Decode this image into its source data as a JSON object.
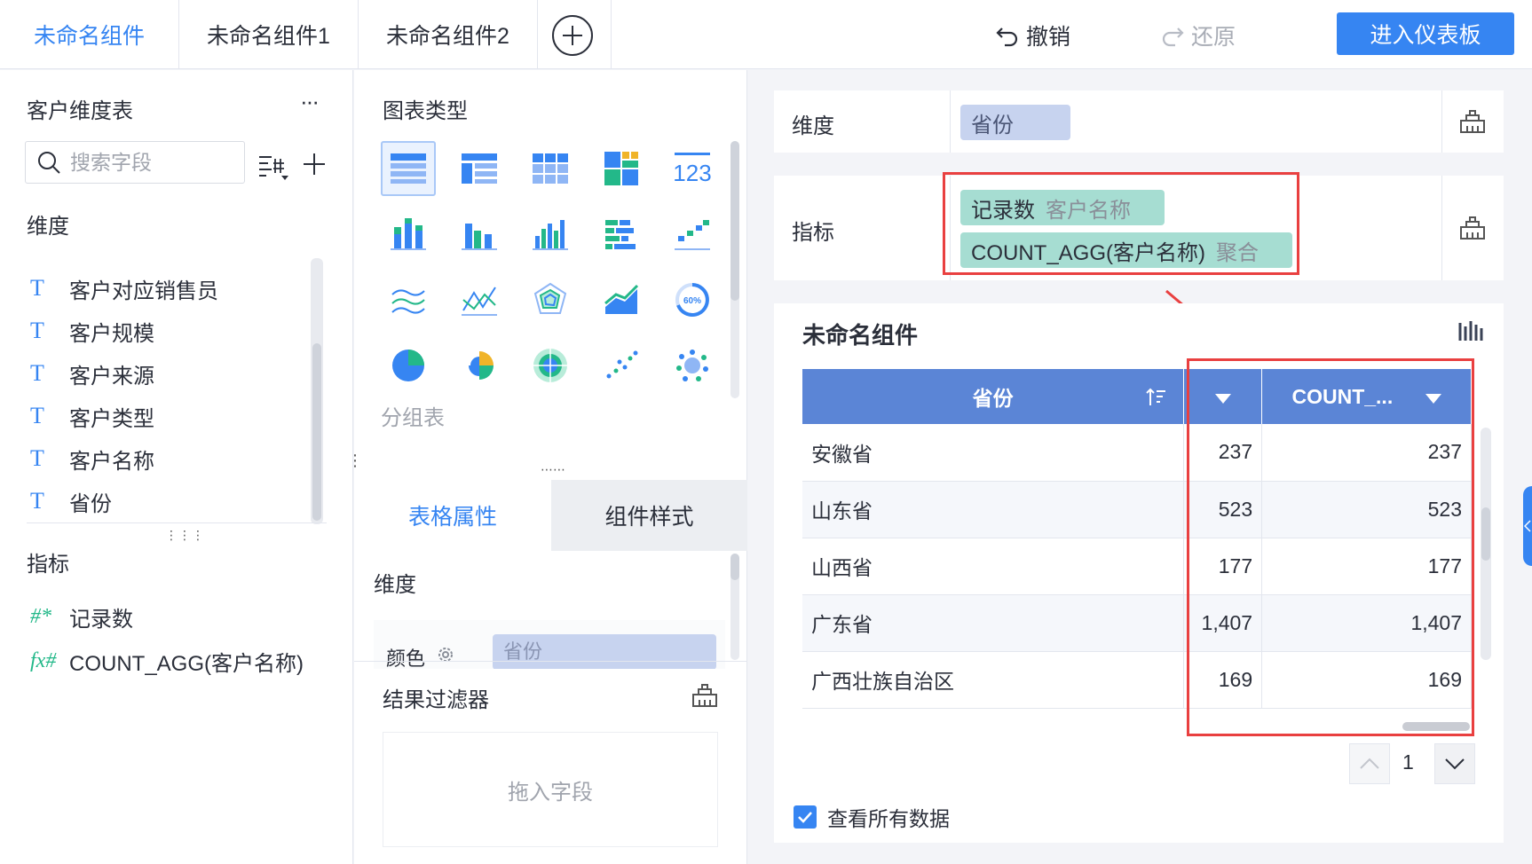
{
  "tabs": [
    {
      "label": "未命名组件",
      "active": true
    },
    {
      "label": "未命名组件1",
      "active": false
    },
    {
      "label": "未命名组件2",
      "active": false
    }
  ],
  "toolbar": {
    "undo": "撤销",
    "redo": "还原",
    "enter_dashboard": "进入仪表板"
  },
  "left": {
    "table_name": "客户维度表",
    "more": "···",
    "search_placeholder": "搜索字段",
    "dimension_title": "维度",
    "dimensions": [
      "客户对应销售员",
      "客户规模",
      "客户来源",
      "客户类型",
      "客户名称",
      "省份"
    ],
    "measure_title": "指标",
    "measures": [
      {
        "icon": "#*",
        "label": "记录数"
      },
      {
        "icon": "fx#",
        "label": "COUNT_AGG(客户名称)"
      }
    ]
  },
  "middle": {
    "chart_type_title": "图表类型",
    "selected_chart_label": "分组表",
    "tabs": [
      "表格属性",
      "组件样式"
    ],
    "dimension_label": "维度",
    "color_label": "颜色",
    "color_field": "省份",
    "filter_title": "结果过滤器",
    "drop_hint": "拖入字段"
  },
  "config": {
    "dimension_label": "维度",
    "dimension_field": "省份",
    "measure_label": "指标",
    "measures": [
      {
        "name": "记录数",
        "source": "客户名称"
      },
      {
        "name": "COUNT_AGG(客户名称)",
        "source": "聚合"
      }
    ]
  },
  "preview": {
    "title": "未命名组件",
    "columns": [
      "省份",
      "",
      "COUNT_..."
    ],
    "rows": [
      [
        "安徽省",
        "237",
        "237"
      ],
      [
        "山东省",
        "523",
        "523"
      ],
      [
        "山西省",
        "177",
        "177"
      ],
      [
        "广东省",
        "1,407",
        "1,407"
      ],
      [
        "广西壮族自治区",
        "169",
        "169"
      ]
    ],
    "page": "1",
    "view_all": "查看所有数据"
  },
  "colors": {
    "accent": "#3685f2",
    "header": "#5b85d6",
    "annotation": "#e94040",
    "dimension_pill": "#c7d3ef",
    "measure_pill": "#a6ddd2"
  }
}
